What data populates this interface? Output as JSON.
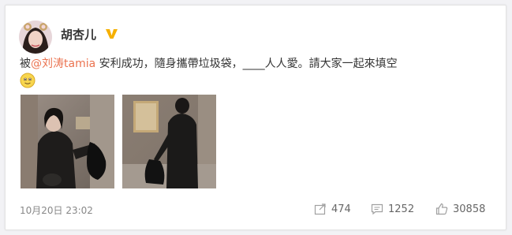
{
  "post": {
    "author": "胡杏儿",
    "text_before": "被",
    "mention": "@刘涛tamia",
    "text_after": " 安利成功，隨身攜帶垃圾袋，____人人愛。請大家一起來填空",
    "emoji_icon": "smile-emoji-icon",
    "timestamp": "10月20日 23:02"
  },
  "actions": {
    "repost_count": "474",
    "comment_count": "1252",
    "like_count": "30858"
  },
  "colors": {
    "mention": "#eb7350",
    "verified": "#f6b000",
    "icon": "#a0a0a0"
  }
}
